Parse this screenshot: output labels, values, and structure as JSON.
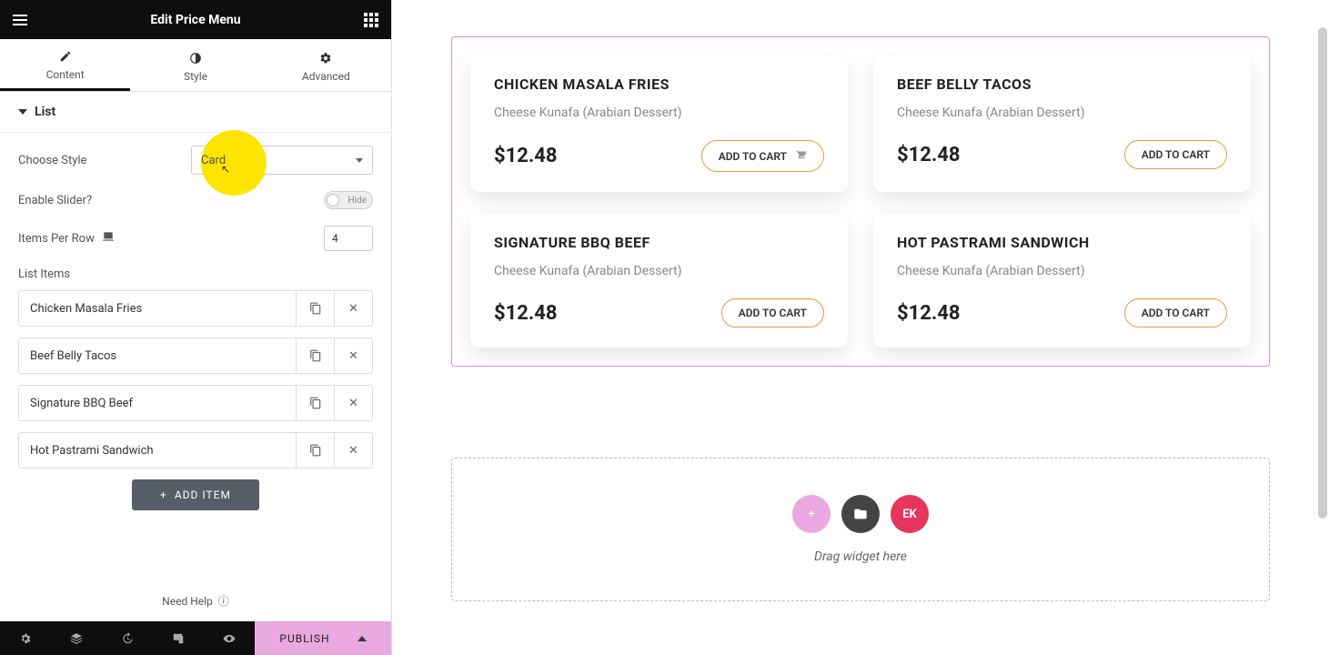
{
  "header": {
    "title": "Edit Price Menu"
  },
  "tabs": {
    "content": "Content",
    "style": "Style",
    "advanced": "Advanced"
  },
  "section": {
    "title": "List"
  },
  "controls": {
    "choose_style_label": "Choose Style",
    "choose_style_value": "Card",
    "enable_slider_label": "Enable Slider?",
    "enable_slider_value": "Hide",
    "items_per_row_label": "Items Per Row",
    "items_per_row_value": "4",
    "list_items_label": "List Items",
    "add_item_label": "ADD ITEM"
  },
  "list_items": [
    {
      "name": "Chicken Masala Fries"
    },
    {
      "name": "Beef Belly Tacos"
    },
    {
      "name": "Signature BBQ Beef"
    },
    {
      "name": "Hot Pastrami Sandwich"
    }
  ],
  "help": {
    "text": "Need Help"
  },
  "bottombar": {
    "publish": "PUBLISH"
  },
  "cards": [
    {
      "title": "CHICKEN MASALA FRIES",
      "subtitle": "Cheese Kunafa (Arabian Dessert)",
      "price": "$12.48",
      "button": "ADD TO CART",
      "icon": true
    },
    {
      "title": "BEEF BELLY TACOS",
      "subtitle": "Cheese Kunafa (Arabian Dessert)",
      "price": "$12.48",
      "button": "ADD TO CART",
      "icon": false
    },
    {
      "title": "SIGNATURE BBQ BEEF",
      "subtitle": "Cheese Kunafa (Arabian Dessert)",
      "price": "$12.48",
      "button": "ADD TO CART",
      "icon": false
    },
    {
      "title": "HOT PASTRAMI SANDWICH",
      "subtitle": "Cheese Kunafa (Arabian Dessert)",
      "price": "$12.48",
      "button": "ADD TO CART",
      "icon": false
    }
  ],
  "dropzone": {
    "text": "Drag widget here",
    "ek": "EK"
  },
  "colors": {
    "accent": "#e9a8e0",
    "highlight": "#ffe400",
    "orange": "#e59b3f",
    "pink_selection": "#d98ee0"
  }
}
